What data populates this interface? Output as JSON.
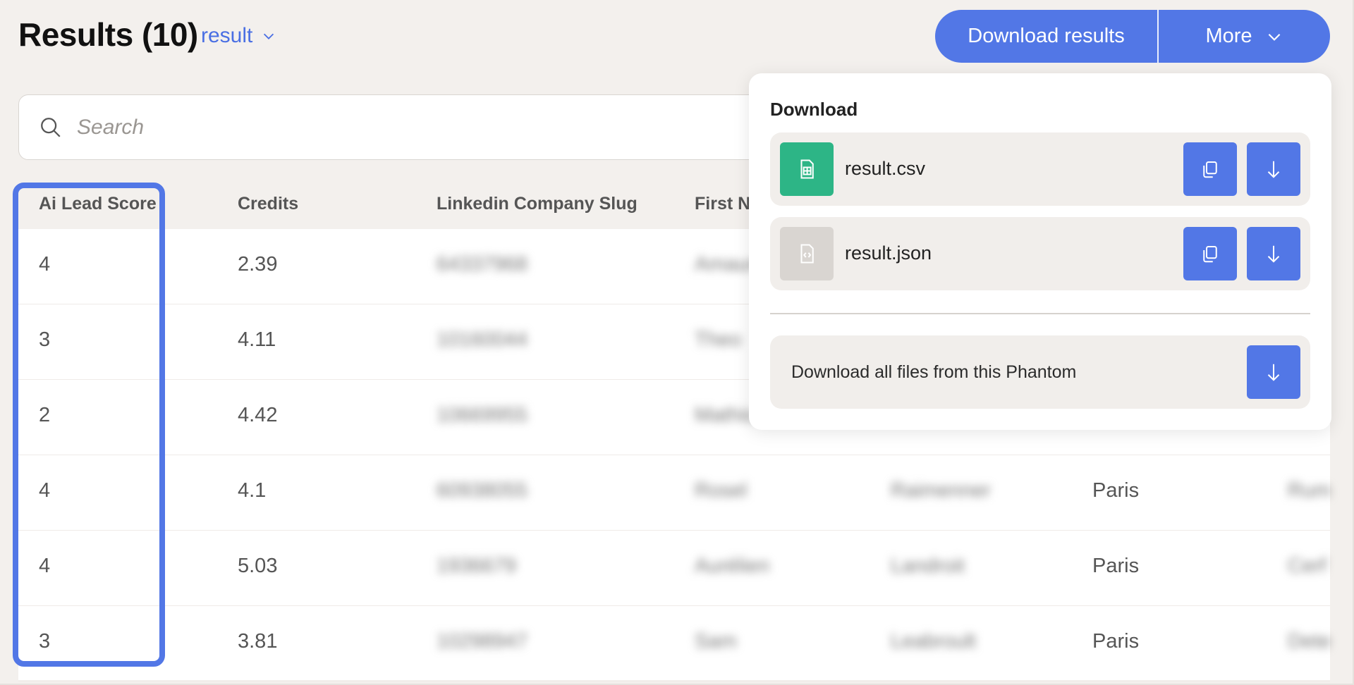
{
  "header": {
    "title": "Results (10)",
    "result_selector": "result",
    "download_button": "Download results",
    "more_button": "More"
  },
  "search": {
    "placeholder": "Search"
  },
  "table": {
    "columns": [
      "Ai Lead Score",
      "Credits",
      "Linkedin Company Slug",
      "First Na"
    ],
    "rows": [
      {
        "score": "4",
        "credits": "2.39",
        "slug": "64337968",
        "first": "Amaury"
      },
      {
        "score": "3",
        "credits": "4.11",
        "slug": "10160044",
        "first": "Theo"
      },
      {
        "score": "2",
        "credits": "4.42",
        "slug": "10669955",
        "first": "Mathis"
      },
      {
        "score": "4",
        "credits": "4.1",
        "slug": "60938055",
        "first": "Rosel",
        "last": "Raimenner",
        "city": "Paris",
        "extra": "Rum"
      },
      {
        "score": "4",
        "credits": "5.03",
        "slug": "1936679",
        "first": "Aurélien",
        "last": "Landroit",
        "city": "Paris",
        "extra": "Cerf"
      },
      {
        "score": "3",
        "credits": "3.81",
        "slug": "10298947",
        "first": "Sam",
        "last": "Leabroult",
        "city": "Paris",
        "extra": "Dete"
      }
    ]
  },
  "dropdown": {
    "section_title": "Download",
    "files": [
      {
        "name": "result.csv",
        "icon": "spreadsheet-icon",
        "icon_color": "#2db586"
      },
      {
        "name": "result.json",
        "icon": "code-file-icon",
        "icon_color": "#d9d5d1"
      }
    ],
    "download_all_label": "Download all files from this Phantom"
  },
  "colors": {
    "accent": "#5277e6",
    "background": "#f3f0ed",
    "csv_green": "#2db586"
  }
}
